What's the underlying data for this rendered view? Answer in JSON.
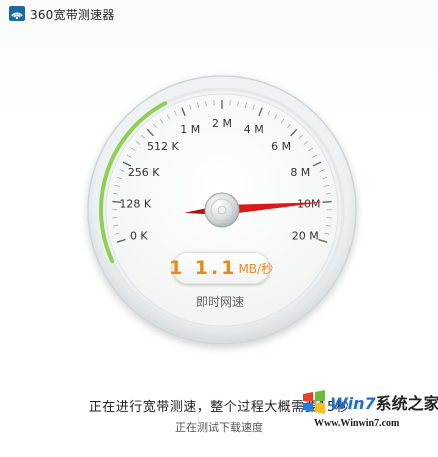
{
  "window": {
    "title": "360宽带测速器"
  },
  "gauge": {
    "ticks": [
      "0 K",
      "128 K",
      "256 K",
      "512 K",
      "1 M",
      "2 M",
      "4 M",
      "6 M",
      "8 M",
      "10M",
      "20 M"
    ],
    "needle_tick_position": 9.0,
    "readout_value": "1 1.1",
    "readout_unit": "MB/秒",
    "caption": "即时网速"
  },
  "colors": {
    "accent_green": "#8fcf55",
    "needle_red": "#d91a1a",
    "readout_orange": "#e98a18"
  },
  "status": {
    "main": "正在进行宽带测速，整个过程大概需要15秒",
    "sub": "正在测试下载速度"
  },
  "watermark": {
    "brand": "Win7",
    "brand_suffix": "系统之家",
    "url": "Www.Winwin7.com"
  }
}
